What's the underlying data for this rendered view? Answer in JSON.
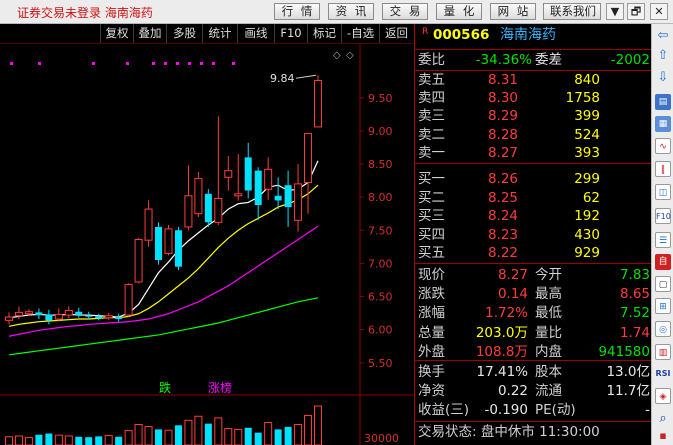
{
  "app": {
    "title": "证券交易未登录  海南海药",
    "menu": [
      "行 情",
      "资 讯",
      "交 易",
      "量 化",
      "网 站",
      "联系我们"
    ],
    "window_buttons": [
      "▼",
      "🗗",
      "✕"
    ]
  },
  "tabs": [
    "复权",
    "叠加",
    "多股",
    "统计",
    "画线",
    "F10",
    "标记",
    "-自选",
    "返回"
  ],
  "chart_data": {
    "type": "candlestick",
    "y_ticks": [
      "9.50",
      "9.00",
      "8.50",
      "8.00",
      "7.50",
      "7.00",
      "6.50",
      "6.00",
      "5.50"
    ],
    "ylim": [
      5.3,
      10.07
    ],
    "candles": [
      {
        "o": 6.14,
        "c": 6.19,
        "h": 6.26,
        "l": 6.08
      },
      {
        "o": 6.21,
        "c": 6.26,
        "h": 6.35,
        "l": 6.16
      },
      {
        "o": 6.24,
        "c": 6.27,
        "h": 6.31,
        "l": 6.21
      },
      {
        "o": 6.26,
        "c": 6.22,
        "h": 6.32,
        "l": 6.16
      },
      {
        "o": 6.23,
        "c": 6.14,
        "h": 6.3,
        "l": 6.08
      },
      {
        "o": 6.16,
        "c": 6.23,
        "h": 6.32,
        "l": 6.12
      },
      {
        "o": 6.22,
        "c": 6.29,
        "h": 6.35,
        "l": 6.17
      },
      {
        "o": 6.27,
        "c": 6.22,
        "h": 6.33,
        "l": 6.18
      },
      {
        "o": 6.21,
        "c": 6.2,
        "h": 6.27,
        "l": 6.15
      },
      {
        "o": 6.2,
        "c": 6.17,
        "h": 6.24,
        "l": 6.14
      },
      {
        "o": 6.18,
        "c": 6.21,
        "h": 6.25,
        "l": 6.15
      },
      {
        "o": 6.19,
        "c": 6.16,
        "h": 6.24,
        "l": 6.12
      },
      {
        "o": 6.22,
        "c": 6.68,
        "h": 6.7,
        "l": 6.2
      },
      {
        "o": 6.72,
        "c": 7.36,
        "h": 7.38,
        "l": 6.7
      },
      {
        "o": 7.35,
        "c": 7.82,
        "h": 7.95,
        "l": 7.25
      },
      {
        "o": 7.55,
        "c": 7.05,
        "h": 7.62,
        "l": 6.98
      },
      {
        "o": 7.15,
        "c": 7.52,
        "h": 7.58,
        "l": 7.12
      },
      {
        "o": 7.5,
        "c": 6.95,
        "h": 7.55,
        "l": 6.9
      },
      {
        "o": 7.55,
        "c": 8.02,
        "h": 8.48,
        "l": 7.5
      },
      {
        "o": 7.75,
        "c": 8.28,
        "h": 8.38,
        "l": 7.7
      },
      {
        "o": 8.05,
        "c": 7.62,
        "h": 8.12,
        "l": 7.55
      },
      {
        "o": 7.62,
        "c": 7.98,
        "h": 9.22,
        "l": 7.58
      },
      {
        "o": 8.3,
        "c": 8.4,
        "h": 8.62,
        "l": 8.1
      },
      {
        "o": 8.02,
        "c": 8.05,
        "h": 8.65,
        "l": 7.95
      },
      {
        "o": 8.6,
        "c": 8.1,
        "h": 8.82,
        "l": 7.98
      },
      {
        "o": 8.4,
        "c": 7.88,
        "h": 8.45,
        "l": 7.66
      },
      {
        "o": 8.12,
        "c": 8.42,
        "h": 8.6,
        "l": 7.96
      },
      {
        "o": 8.02,
        "c": 7.95,
        "h": 8.3,
        "l": 7.82
      },
      {
        "o": 8.18,
        "c": 7.85,
        "h": 8.4,
        "l": 7.55
      },
      {
        "o": 7.65,
        "c": 8.2,
        "h": 8.5,
        "l": 7.48
      },
      {
        "o": 8.22,
        "c": 8.96,
        "h": 8.96,
        "l": 7.75
      },
      {
        "o": 9.06,
        "c": 9.76,
        "h": 9.84,
        "l": 9.06
      }
    ],
    "ma5": [
      6.18,
      6.2,
      6.22,
      6.23,
      6.22,
      6.22,
      6.23,
      6.22,
      6.22,
      6.21,
      6.2,
      6.19,
      6.25,
      6.38,
      6.62,
      6.86,
      7.02,
      7.2,
      7.34,
      7.46,
      7.58,
      7.68,
      7.82,
      7.9,
      7.92,
      8.0,
      8.15,
      8.18,
      8.1,
      8.12,
      8.22,
      8.55
    ],
    "ma10": [
      6.05,
      6.08,
      6.1,
      6.12,
      6.13,
      6.14,
      6.15,
      6.16,
      6.16,
      6.17,
      6.18,
      6.18,
      6.2,
      6.24,
      6.32,
      6.42,
      6.54,
      6.66,
      6.78,
      6.92,
      7.08,
      7.24,
      7.38,
      7.5,
      7.6,
      7.68,
      7.76,
      7.85,
      7.9,
      7.96,
      8.05,
      8.18
    ],
    "ma20": [
      5.9,
      5.93,
      5.96,
      5.99,
      6.01,
      6.03,
      6.05,
      6.06,
      6.08,
      6.09,
      6.1,
      6.11,
      6.12,
      6.14,
      6.16,
      6.2,
      6.24,
      6.3,
      6.36,
      6.42,
      6.5,
      6.58,
      6.66,
      6.76,
      6.86,
      6.96,
      7.06,
      7.16,
      7.26,
      7.36,
      7.46,
      7.56
    ],
    "ma60": [
      5.62,
      5.64,
      5.66,
      5.68,
      5.7,
      5.72,
      5.74,
      5.76,
      5.78,
      5.8,
      5.82,
      5.84,
      5.86,
      5.88,
      5.9,
      5.92,
      5.95,
      5.98,
      6.01,
      6.04,
      6.07,
      6.1,
      6.14,
      6.18,
      6.22,
      6.26,
      6.3,
      6.34,
      6.38,
      6.42,
      6.45,
      6.48
    ],
    "high_label": "9.84",
    "annotations": [
      "跌",
      "涨榜"
    ],
    "volume_label": "30000",
    "volume": [
      20,
      22,
      18,
      25,
      28,
      24,
      22,
      20,
      19,
      21,
      23,
      20,
      35,
      50,
      45,
      38,
      36,
      48,
      60,
      70,
      52,
      66,
      40,
      38,
      42,
      30,
      55,
      38,
      44,
      50,
      72,
      95
    ]
  },
  "quote": {
    "marker": "R",
    "code": "000566",
    "name": "海南海药",
    "weibi_label": "委比",
    "weibi_value": "-34.36%",
    "weicha_label": "委差",
    "weicha_value": "-2002",
    "sells": [
      {
        "label": "卖五",
        "price": "8.31",
        "vol": "840"
      },
      {
        "label": "卖四",
        "price": "8.30",
        "vol": "1758"
      },
      {
        "label": "卖三",
        "price": "8.29",
        "vol": "399"
      },
      {
        "label": "卖二",
        "price": "8.28",
        "vol": "524"
      },
      {
        "label": "卖一",
        "price": "8.27",
        "vol": "393"
      }
    ],
    "buys": [
      {
        "label": "买一",
        "price": "8.26",
        "vol": "299"
      },
      {
        "label": "买二",
        "price": "8.25",
        "vol": "62"
      },
      {
        "label": "买三",
        "price": "8.24",
        "vol": "192"
      },
      {
        "label": "买四",
        "price": "8.23",
        "vol": "430"
      },
      {
        "label": "买五",
        "price": "8.22",
        "vol": "929"
      }
    ],
    "stats1": [
      {
        "l1": "现价",
        "v1": "8.27",
        "l2": "今开",
        "v2": "7.83"
      },
      {
        "l1": "涨跌",
        "v1": "0.14",
        "l2": "最高",
        "v2": "8.65"
      },
      {
        "l1": "涨幅",
        "v1": "1.72%",
        "l2": "最低",
        "v2": "7.52"
      },
      {
        "l1": "总量",
        "v1": "203.0万",
        "l2": "量比",
        "v2": "1.74"
      },
      {
        "l1": "外盘",
        "v1": "108.8万",
        "l2": "内盘",
        "v2": "941580"
      }
    ],
    "stats2": [
      {
        "l1": "换手",
        "v1": "17.41%",
        "l2": "股本",
        "v2": "13.0亿"
      },
      {
        "l1": "净资",
        "v1": "0.22",
        "l2": "流通",
        "v2": "11.7亿"
      },
      {
        "l1": "收益(三)",
        "v1": "-0.190",
        "l2": "PE(动)",
        "v2": "-"
      }
    ],
    "status": "交易状态: 盘中休市 11:30:00"
  },
  "colors": {
    "up": "#ff3c3c",
    "down": "#00e0ff",
    "ma5": "#ffffff",
    "ma10": "#ffff00",
    "ma20": "#ff00ff",
    "ma60": "#00ff00",
    "accent": "#b00000"
  }
}
